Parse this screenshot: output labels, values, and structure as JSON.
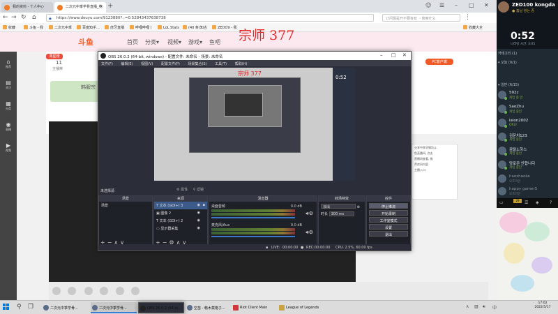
{
  "browser": {
    "tabs": [
      {
        "label": "我的资料 - 个人中心"
      },
      {
        "label": "二次元中季学骨直播_英"
      }
    ],
    "url": "https://www.douyu.com/9123880?  ;=0.52843437638738",
    "search_placeholder": "订问题是开不要有有 ・搜索什么",
    "bookmarks": [
      "收藏",
      "斗鱼 - 我",
      "二次元中季",
      "百度知乎...",
      "虎牙直播",
      "哔哩哔哩 (",
      "LoL Stats",
      "(40 条)知古",
      "ZEDO9 - 我",
      "收藏大全"
    ]
  },
  "douyu": {
    "logo": "斗鱼",
    "nav": [
      "首页",
      "分类▾",
      "视频▾",
      "游戏▾",
      "鱼吧"
    ],
    "watermark": "宗师 377",
    "rank_label": "周星榜",
    "rank_value": "11",
    "rank_sub": "主播荣",
    "banner_label": "韩服宗",
    "pc_button": "PC客户端",
    "rail": [
      {
        "icon": "⌂",
        "label": "推荐"
      },
      {
        "icon": "▤",
        "label": "关注"
      },
      {
        "icon": "▦",
        "label": "分类"
      },
      {
        "icon": "◉",
        "label": "直播"
      },
      {
        "icon": "▶",
        "label": "视频"
      }
    ],
    "sidecard_lines": [
      "分享中季学钢坊斗",
      "鱼直播间, 点击",
      "直播间查看, 推",
      "荐房间内容",
      "主播入口"
    ]
  },
  "obs": {
    "title": "OBS 26.0.2 (64-bit, windows) - 配置文件: 未命名 - 场景: 未命名",
    "menu": [
      "文件(F)",
      "编辑(E)",
      "视图(V)",
      "配置文件(P)",
      "场景集合(S)",
      "工具(T)",
      "帮助(H)"
    ],
    "preview_watermark": "宗师 377",
    "preview_timer": "0:52",
    "scene_header": "未选择源",
    "props_labels": [
      "属性",
      "滤镜"
    ],
    "docks": {
      "scenes": {
        "title": "场景",
        "items": [
          "场景"
        ]
      },
      "sources": {
        "title": "来源",
        "items": [
          "文本 (GDI+) 3",
          "图像 2",
          "文本 (GDI+) 2",
          "显示器采集"
        ]
      },
      "mixer": {
        "title": "混音器",
        "channels": [
          {
            "name": "桌面音频",
            "db": "0.0 dB"
          },
          {
            "name": "麦克风/Aux",
            "db": "0.0 dB"
          }
        ]
      },
      "transitions": {
        "title": "转场特效",
        "type": "淡出",
        "duration_label": "时长",
        "duration": "300 ms"
      },
      "controls": {
        "title": "控件",
        "buttons": [
          "停止推流",
          "开始录制",
          "工作室模式",
          "设置",
          "退出"
        ]
      }
    },
    "status": {
      "live": "LIVE:",
      "live_time": "00:00:00",
      "rec": "REC:",
      "rec_time": "00:00:00",
      "cpu": "CPU: 2.5%, 60.00 fps"
    }
  },
  "client": {
    "user": "ZED100 kongda",
    "user_sub": "● 홈닐 왕는 중",
    "timer": "0:52",
    "timer_sub": "나라당 시간: 3:05",
    "section_label": "카테고리 (1)",
    "groups": [
      {
        "label": "▾ 일반 (6/15)"
      }
    ],
    "top_group": "▾ 오늘 (0/1)",
    "friends": [
      {
        "name": "592z",
        "status": "게임 중 인"
      },
      {
        "name": "SaoZhu",
        "status": "게임 중인"
      },
      {
        "name": "lalon2002",
        "status": "ORLY"
      },
      {
        "name": "김운치123",
        "status": "게임 중인"
      },
      {
        "name": "꿈탈노하스",
        "status": "게임 중인"
      },
      {
        "name": "망로콘 안합니다",
        "status": "게임 중인"
      },
      {
        "name": "haozhaoke",
        "status": "오프라인"
      },
      {
        "name": "happy gamer5",
        "status": "오프라인"
      }
    ],
    "bottom_badge": "29",
    "clock_time": "17:02",
    "clock_date": "2022/5/17"
  },
  "taskbar": {
    "items": [
      {
        "label": "二次元中季学骨..."
      },
      {
        "label": "二次元中季学骨..."
      },
      {
        "label": "OBS 26.0.2 (64-bi..."
      },
      {
        "label": "空苗 - 韩木莫格子..."
      },
      {
        "label": "Riot Client Main"
      },
      {
        "label": "League of Legends"
      }
    ],
    "tray_lang": "中",
    "tray_time": "17:02"
  }
}
